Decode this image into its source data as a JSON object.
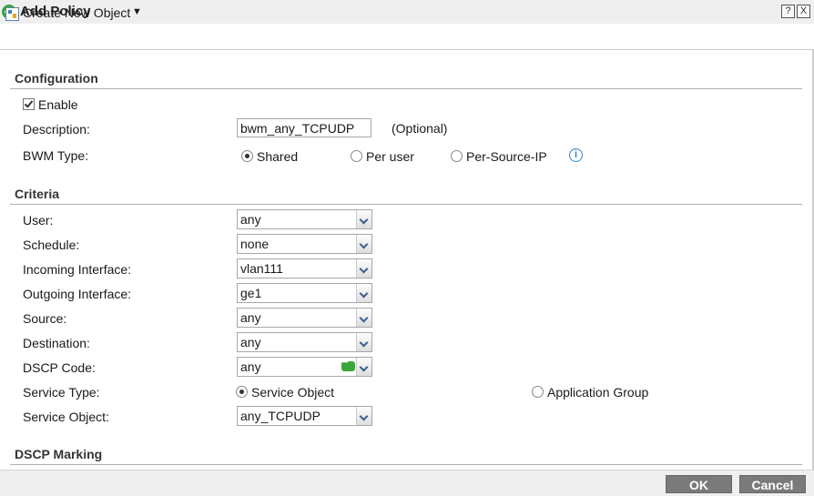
{
  "window": {
    "title": "Add Policy",
    "help_label": "?",
    "close_label": "X"
  },
  "toolbar": {
    "create_new_object": "Create New Object"
  },
  "configuration": {
    "heading": "Configuration",
    "enable_label": "Enable",
    "enable_checked": true,
    "description_label": "Description:",
    "description_value": "bwm_any_TCPUDP",
    "description_hint": "(Optional)",
    "bwm_type_label": "BWM Type:",
    "bwm_options": [
      "Shared",
      "Per user",
      "Per-Source-IP"
    ],
    "bwm_selected": "Shared"
  },
  "criteria": {
    "heading": "Criteria",
    "user_label": "User:",
    "user_value": "any",
    "schedule_label": "Schedule:",
    "schedule_value": "none",
    "incoming_label": "Incoming Interface:",
    "incoming_value": "vlan111",
    "outgoing_label": "Outgoing Interface:",
    "outgoing_value": "ge1",
    "source_label": "Source:",
    "source_value": "any",
    "destination_label": "Destination:",
    "destination_value": "any",
    "dscp_label": "DSCP Code:",
    "dscp_value": "any",
    "service_type_label": "Service Type:",
    "service_type_options": [
      "Service Object",
      "Application Group"
    ],
    "service_type_selected": "Service Object",
    "service_object_label": "Service Object:",
    "service_object_value": "any_TCPUDP"
  },
  "dscp_marking": {
    "heading": "DSCP Marking"
  },
  "footer": {
    "ok_label": "OK",
    "cancel_label": "Cancel"
  },
  "colors": {
    "accent_add": "#3aa63a",
    "info": "#2f86d2",
    "button_bg": "#7a7a7a"
  }
}
